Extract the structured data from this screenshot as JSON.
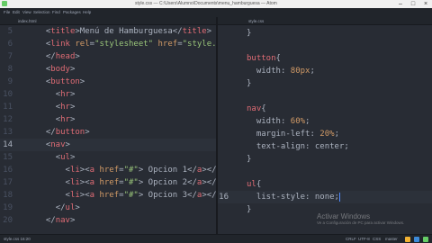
{
  "window": {
    "title": "style.css — C:\\Users\\Alumno\\Documents\\menu_hamburguesa — Atom",
    "minimize_glyph": "–",
    "maximize_glyph": "□",
    "close_glyph": "×"
  },
  "menu": [
    "File",
    "Edit",
    "View",
    "Selection",
    "Find",
    "Packages",
    "Help"
  ],
  "tabs": {
    "left": "index.html",
    "right": "style.css"
  },
  "left_editor": {
    "lines": [
      {
        "n": "5",
        "text": "  <title>Menú de Hamburguesa</title>"
      },
      {
        "n": "6",
        "text": "  <link rel=\"stylesheet\" href=\"style.css\">"
      },
      {
        "n": "7",
        "text": "  </head>"
      },
      {
        "n": "8",
        "text": "  <body>"
      },
      {
        "n": "9",
        "text": "  <button>"
      },
      {
        "n": "10",
        "text": "    <hr>"
      },
      {
        "n": "11",
        "text": "    <hr>"
      },
      {
        "n": "12",
        "text": "    <hr>"
      },
      {
        "n": "13",
        "text": "  </button>"
      },
      {
        "n": "14",
        "text": "  <nav>"
      },
      {
        "n": "15",
        "text": "    <ul>"
      },
      {
        "n": "16",
        "text": "      <li><a href=\"#\"> Opcion 1</a></li>"
      },
      {
        "n": "17",
        "text": "      <li><a href=\"#\"> Opcion 2</a></li>"
      },
      {
        "n": "18",
        "text": "      <li><a href=\"#\"> Opcion 3</a></li>"
      },
      {
        "n": "19",
        "text": "    </ul>"
      },
      {
        "n": "20",
        "text": "  </nav>"
      }
    ]
  },
  "right_editor": {
    "lines": [
      {
        "n": "",
        "text": "}"
      },
      {
        "n": "",
        "text": ""
      },
      {
        "n": "",
        "text": "button{"
      },
      {
        "n": "",
        "text": "  width: 80px;"
      },
      {
        "n": "",
        "text": "}"
      },
      {
        "n": "",
        "text": ""
      },
      {
        "n": "",
        "text": "nav{"
      },
      {
        "n": "",
        "text": "  width: 60%;"
      },
      {
        "n": "",
        "text": "  margin-left: 20%;"
      },
      {
        "n": "",
        "text": "  text-align: center;"
      },
      {
        "n": "",
        "text": "}"
      },
      {
        "n": "",
        "text": ""
      },
      {
        "n": "",
        "text": "ul{"
      },
      {
        "n": "16",
        "text": "  list-style: none;"
      },
      {
        "n": "",
        "text": "}"
      }
    ]
  },
  "status": {
    "left": "style.css  16:20",
    "right": [
      "CRLF",
      "UTF-8",
      "CSS",
      "master"
    ]
  },
  "watermark": {
    "title": "Activar Windows",
    "subtitle": "Ve a Configuración de PC para activar Windows."
  },
  "colors": {
    "editor_bg": "#282c34",
    "chrome_bg": "#21252b",
    "tag": "#e06c75",
    "attr": "#d19a66",
    "string": "#98c379",
    "number": "#d19a66",
    "text": "#abb2bf"
  }
}
